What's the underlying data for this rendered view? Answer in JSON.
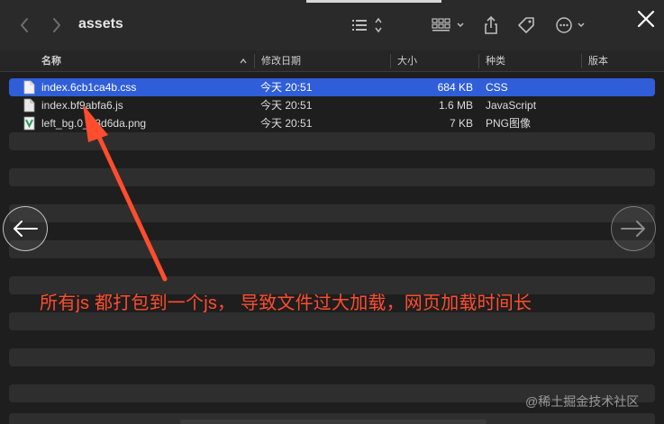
{
  "window": {
    "folder_title": "assets"
  },
  "toolbar": {
    "back_icon": "chevron-left-icon",
    "forward_icon": "chevron-right-icon",
    "view_icon": "list-view-icon",
    "group_icon": "grid-group-icon",
    "share_icon": "share-icon",
    "tag_icon": "tag-icon",
    "more_icon": "ellipsis-icon",
    "close_icon": "close-icon"
  },
  "columns": {
    "name": "名称",
    "date": "修改日期",
    "size": "大小",
    "kind": "种类",
    "version": "版本"
  },
  "files": [
    {
      "name": "index.6cb1ca4b.css",
      "date": "今天 20:51",
      "size": "684 KB",
      "kind": "CSS",
      "selected": true
    },
    {
      "name": "index.bf9abfa6.js",
      "date": "今天 20:51",
      "size": "1.6 MB",
      "kind": "JavaScript",
      "selected": false
    },
    {
      "name": "left_bg.0__3d6da.png",
      "date": "今天 20:51",
      "size": "7 KB",
      "kind": "PNG图像",
      "selected": false
    }
  ],
  "overlay": {
    "annotation": "所有js 都打包到一个js， 导致文件过大加载，网页加载时间长",
    "watermark": "@稀土掘金技术社区",
    "accent_color": "#ff4d2e",
    "selection_color": "#2f5ed8"
  }
}
